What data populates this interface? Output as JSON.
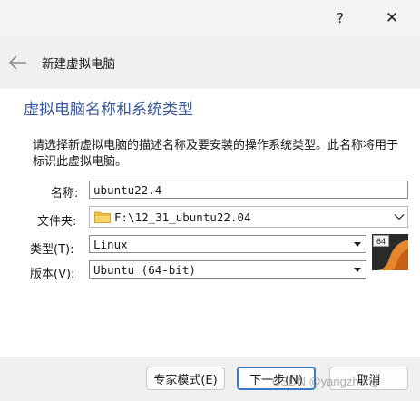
{
  "window": {
    "help_glyph": "?",
    "close_glyph": "✕"
  },
  "wizard": {
    "title": "新建虚拟电脑"
  },
  "page": {
    "heading": "虚拟电脑名称和系统类型",
    "description": "请选择新虚拟电脑的描述名称及要安装的操作系统类型。此名称将用于标识此虚拟电脑。"
  },
  "form": {
    "name_label": "名称:",
    "name_value": "ubuntu22.4",
    "folder_label": "文件夹:",
    "folder_value": "F:\\12_31_ubuntu22.04",
    "type_label": "类型(T):",
    "type_value": "Linux",
    "version_label": "版本(V):",
    "version_value": "Ubuntu (64-bit)",
    "os_badge": "64"
  },
  "buttons": {
    "expert": "专家模式(E)",
    "next": "下一步(N)",
    "cancel": "取消"
  },
  "watermark": "CSDN @yangzhong"
}
